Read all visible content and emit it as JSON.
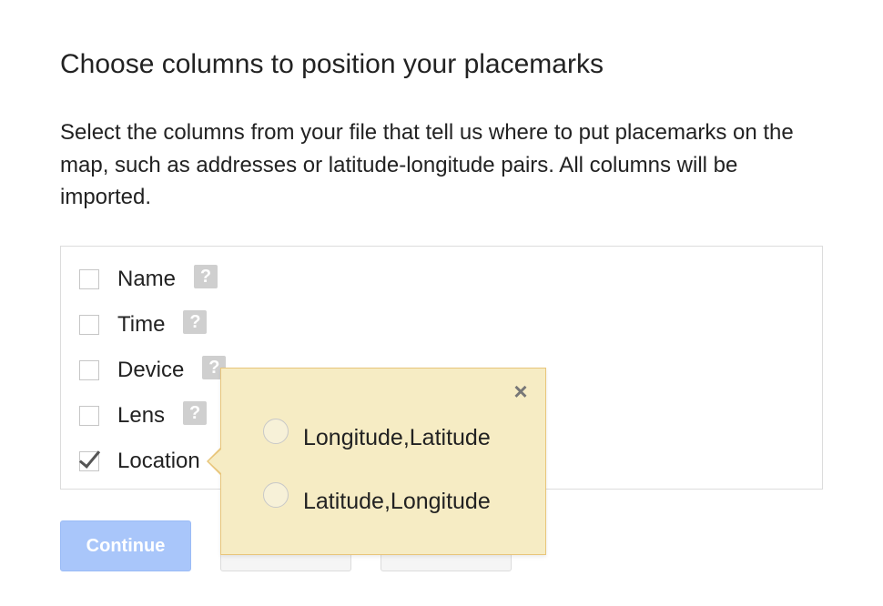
{
  "header": {
    "title": "Choose columns to position your placemarks",
    "description": "Select the columns from your file that tell us where to put placemarks on the map, such as addresses or latitude-longitude pairs. All columns will be imported."
  },
  "columns": [
    {
      "label": "Name",
      "checked": false
    },
    {
      "label": "Time",
      "checked": false
    },
    {
      "label": "Device",
      "checked": false
    },
    {
      "label": "Lens",
      "checked": false
    },
    {
      "label": "Location",
      "checked": true
    }
  ],
  "help_icon_glyph": "?",
  "popup": {
    "close_glyph": "×",
    "options": [
      {
        "label": "Longitude,Latitude",
        "selected": false
      },
      {
        "label": "Latitude,Longitude",
        "selected": false
      }
    ]
  },
  "buttons": {
    "continue_label": "Continue",
    "back_label": "",
    "cancel_label": ""
  },
  "colors": {
    "continue_bg": "#a9c6fa",
    "popup_bg": "#f6ecc4",
    "popup_border": "#e8c57a"
  }
}
